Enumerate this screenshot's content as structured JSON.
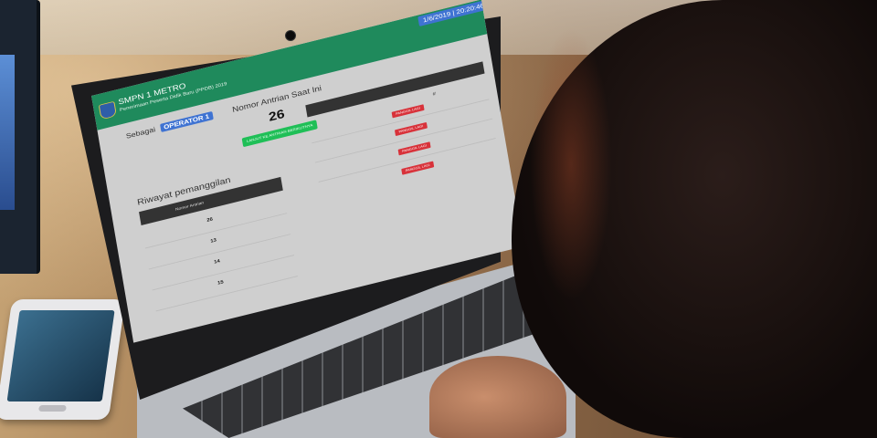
{
  "app": {
    "title": "SMPN 1 METRO",
    "subtitle": "Penerimaan Peserta Didik Baru (PPDB) 2019",
    "datetime": "1/6/2019 | 20:20:46"
  },
  "operator": {
    "prefix": "Sebagai",
    "badge": "OPERATOR 1"
  },
  "current_queue": {
    "heading": "Nomor Antrian Saat Ini",
    "number": "26",
    "next_button": "LANJUT KE ANTRIAN BERIKUTNYA"
  },
  "call_table": {
    "right_header": "#",
    "call_buttons": [
      "PANGGIL LAGI",
      "PANGGIL LAGI",
      "PANGGIL LAGI",
      "PANGGIL LAGI"
    ]
  },
  "history": {
    "title": "Riwayat pemanggilan",
    "column_header": "Nomor Antrian",
    "rows": [
      "26",
      "13",
      "14",
      "15"
    ]
  },
  "colors": {
    "header_green": "#1f8a5c",
    "badge_blue": "#3f73d2",
    "next_green": "#1fbf57",
    "call_red": "#d8323a"
  }
}
